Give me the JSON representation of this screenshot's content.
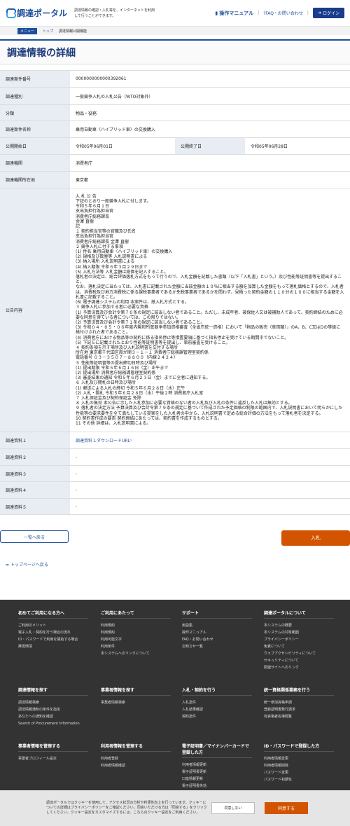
{
  "header": {
    "logo": "調達ポータル",
    "tagline": "調達情報の確認・入札等を、インターネットを利用して行うことができます。",
    "manual": "操作マニュアル",
    "faq": "FAQ・お問い合わせ",
    "login": "ログイン"
  },
  "crumb": {
    "menu": "メニュー",
    "top": "トップ",
    "current": "調達情報公開機能"
  },
  "title": "調達情報の詳細",
  "rows": {
    "r1": {
      "label": "調達案件番号",
      "value": "0000000000000392061"
    },
    "r2": {
      "label": "調達種別",
      "value": "一般競争入札の入札公告（WTO対象外）"
    },
    "r3": {
      "label": "分類",
      "value": "物品・役務"
    },
    "r4": {
      "label": "調達案件名称",
      "value": "乗用自動車（ハイブリッド車）の交換購入"
    },
    "r5": {
      "label": "公開開始日",
      "value": "令和05年06月01日",
      "label2": "公開終了日",
      "value2": "令和05年06月28日"
    },
    "r6": {
      "label": "調達機関",
      "value": "消費者庁"
    },
    "r7": {
      "label": "調達機関所在地",
      "value": "東京都"
    },
    "r8": {
      "label": "公告内容",
      "value": "入 札 公 告\n下記のとおり一般競争入札に付します。\n令和５年６月１日\n支出負担行為担当官\n消費者庁総務課長\n金澤 直樹\n記\n１ 契約担当官等の官職及び氏名\n支出負担行為担当官\n消費者庁総務課長 金澤 直樹\n２ 競争入札に付する事項\n(1) 件名 乗用自動車（ハイブリッド車）の交換購入\n(2) 規格及び数量等 入札説明書による\n(3) 納入場所 入札説明書による\n(4) 納入期限 令和６年３月２９日まで\n(5) 入札方法等 入札金額は総価を記入すること。\n落札者の決定は、総合評価落札方式をもって行うので、入札金額を記載した書類（以下「入札書」という。）及び性能等証明書等を提出すること。\nなお、落札決定に当たっては、入札書に記載された金額に当該金額の１０％に相当する額を加算した金額をもって落札価格とするので、入札者は、消費税及び地方消費税に係る課税事業者であるか免税事業者であるかを問わず、見積った契約金額の１１０分の１００に相当する金額を入札書に記載すること。\n(6) 電子調達システムの利用 本案件は、紙入札方式とする。\n３ 競争入札に参加する者に必要な資格\n(1) 予算決算及び会計令第７０条の規定に該当しない者であること。ただし、未成年者、被保佐人又は被補助人であって、契約締結のために必要な同意を得ている者については、この限りではない。\n(2) 予算決算及び会計令第７１条の規定に該当しない者であること。\n(3) 令和０４・０５・０６年度内閣府所管競争参加資格審査（全省庁統一資格）において「物品の販売（車両類）」のA、B、C又はDの等級に格付けされた者であること。\n(4) 消費者庁における物品等の契約に係る指名停止等措置要領に基づく指名停止を受けている期間中でないこと。\n(5) 下記５に記載されたとおり性能等証明書等を提出し、事前審査を受けること。\n４ 契約条項を示す場所及び入札説明書を交付する場所\n所在地 東京都千代田区霞が関３－１－１ 消費者庁総務課管理室契約係\n電話番号 ０３－３５０７－８８００（内線２４２４）\n５ 性能等証明書等の提出締切日時及び場所\n(1) 提出期限 令和５年６月１６日（金）正午まで\n(2) 提出場所 消費者庁総務課管理室契約係\n(3) 審査結果の通知 令和５年６月２３日（金）までに全者に通知する。\n６ 入札及び開札の日時及び場所\n(1) 郵送による入札の締切 令和５年６月２８日（水）正午\n(2) 入札・開札 令和５年６月２８日（水）午後２時 消費者庁入札室\n７ 入札保証金及び契約保証金 免除\n８ 入札の無効 本公告に示した入札参加に必要な資格のない者の入札及び入札の条件に違反した入札は無効とする。\n９ 落札者の決定方法 予算決算及び会計令第７９条の規定に基づいて作成された予定価格の制限の範囲内で、入札説明書において明らかにした性能等の要求要件を全て満たしている提案をした入札者の中から、入札説明書で定める総合評価の方法をもって落札者を決定する。\n10 契約書作成の要否 契約締結にあたっては、契約書を作成するものとする。\n11 その他 詳細は、入札説明書による。"
    },
    "r9": {
      "label": "調達資料１",
      "value": "調達資料１ダウンロードURL"
    },
    "r10": {
      "label": "調達資料２",
      "value": "-"
    },
    "r11": {
      "label": "調達資料３",
      "value": "-"
    },
    "r12": {
      "label": "調達資料４",
      "value": "-"
    },
    "r13": {
      "label": "調達資料５",
      "value": "-"
    }
  },
  "buttons": {
    "back": "一覧へ戻る",
    "bid": "入札"
  },
  "pagetop": "トップページへ戻る",
  "footer": {
    "c1": {
      "title": "初めてご利用になる方へ",
      "items": [
        "ご利用のメリット",
        "電子入札・契約を行う場合の流れ",
        "ID・パスワードで利用を開始する場合",
        "推奨環境"
      ]
    },
    "c2": {
      "title": "ご利用にあたって",
      "items": [
        "利用規約",
        "利用規約",
        "利用可能文字",
        "利用条件",
        "本システムへのリンクについて"
      ]
    },
    "c3": {
      "title": "サポート",
      "items": [
        "用語集",
        "操作マニュアル",
        "FAQ・お問い合わせ",
        "お知らせ一覧"
      ]
    },
    "c4": {
      "title": "調達ポータルについて",
      "items": [
        "本システムの概要",
        "本システムの対象範囲",
        "プライバシーポリシー",
        "免責について",
        "ウェブアクセシビリティについて",
        "セキュリティについて",
        "関連サイトへのリンク"
      ]
    },
    "c5": {
      "title": "調達情報を探す",
      "items": [
        "調達情報検索",
        "調達情報通知の条件を指定",
        "あなたへの通知を確認",
        "Search of Procurement Information"
      ]
    },
    "c6": {
      "title": "事業者情報を探す",
      "items": [
        "事業者情報検索"
      ]
    },
    "c7": {
      "title": "入札・契約を行う",
      "items": [
        "入札案件",
        "入札結果確認",
        "契約案件"
      ]
    },
    "c8": {
      "title": "統一資格関係業務を行う",
      "items": [
        "統一参加資格申請",
        "登録証明書発行請求",
        "有資格者名簿閲覧"
      ]
    },
    "c9": {
      "title": "事業者情報を管理する",
      "items": [
        "事業者プロフィール設定"
      ]
    },
    "c10": {
      "title": "利用者情報を管理する",
      "items": [
        "利用者登録",
        "利用者情報確認"
      ]
    },
    "c11": {
      "title": "電子証明書／マイナンバーカードで登録した方",
      "items": [
        "利用者情報更新",
        "電子証明書更新",
        "口座情報更新",
        "電子証明書失効"
      ]
    },
    "c12": {
      "title": "ID・パスワードで登録した方",
      "items": [
        "利用者情報変更",
        "利用者情報削除",
        "パスワード変更",
        "パスワード初期化"
      ]
    }
  },
  "cookie": {
    "text": "調達ポータルではクッキーを使用して、アクセス状況の分析や利便性向上を行っています。クッキーについての詳細はプライバシーポリシーをご確認ください。同意いただける方は「同意する」をクリックしてください。クッキー設定をカスタマイズするには、こちらのクッキー設定をご利用ください。",
    "deny": "同意しない",
    "agree": "同意する"
  }
}
